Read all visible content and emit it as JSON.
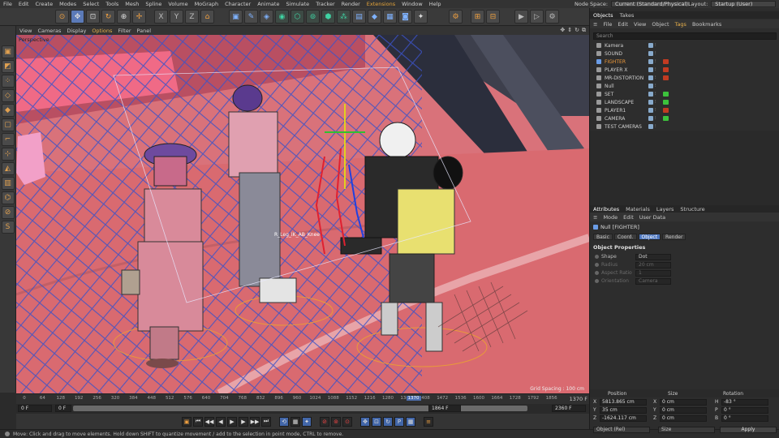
{
  "menubar": {
    "items": [
      "File",
      "Edit",
      "Create",
      "Modes",
      "Select",
      "Tools",
      "Mesh",
      "Spline",
      "Volume",
      "MoGraph",
      "Character",
      "Animate",
      "Simulate",
      "Tracker",
      "Render",
      "Extensions",
      "Window",
      "Help"
    ],
    "node_space_label": "Node Space:",
    "node_space_value": "Current (Standard/Physical)",
    "layout_label": "Layout:",
    "layout_value": "Startup (User)"
  },
  "viewport": {
    "menu": [
      "View",
      "Cameras",
      "Display",
      "Options",
      "Filter",
      "Panel"
    ],
    "label": "Perspective",
    "grid_spacing": "Grid Spacing : 100 cm",
    "bone_label": "R_Leg_IK_AB_Knee"
  },
  "timeline": {
    "ticks": [
      "0",
      "64",
      "128",
      "192",
      "256",
      "320",
      "384",
      "448",
      "512",
      "576",
      "640",
      "704",
      "768",
      "832",
      "896",
      "960",
      "1024",
      "1088",
      "1152",
      "1216",
      "1280",
      "1344",
      "1408",
      "1472",
      "1536",
      "1600",
      "1664",
      "1728",
      "1792",
      "1856"
    ],
    "current_frame": "1370",
    "end_display": "1370 F",
    "range_start": "0 F",
    "range_start2": "0 F",
    "range_mid": "1864 F",
    "range_end": "2360 F"
  },
  "status": {
    "text": "Move: Click and drag to move elements. Hold down SHIFT to quantize movement / add to the selection in point mode, CTRL to remove."
  },
  "objects_panel": {
    "tabs": [
      "Objects",
      "Takes"
    ],
    "menu": [
      "File",
      "Edit",
      "View",
      "Object",
      "Tags",
      "Bookmarks"
    ],
    "search_placeholder": "Search",
    "items": [
      {
        "name": "Kamera",
        "color": "#9a9a9a",
        "name_color": "#d0d0d0",
        "tag": ""
      },
      {
        "name": "SOUND",
        "color": "#9a9a9a",
        "name_color": "#d0d0d0",
        "tag": ""
      },
      {
        "name": "FIGHTER",
        "color": "#6a9ce6",
        "name_color": "#f09a3a",
        "tag": "#c23b22"
      },
      {
        "name": "PLAYER X",
        "color": "#9a9a9a",
        "name_color": "#d0d0d0",
        "tag": "#c23b22"
      },
      {
        "name": "MR-DISTORTION",
        "color": "#9a9a9a",
        "name_color": "#d0d0d0",
        "tag": "#c23b22"
      },
      {
        "name": "Null",
        "color": "#9a9a9a",
        "name_color": "#d0d0d0",
        "tag": ""
      },
      {
        "name": "SET",
        "color": "#9a9a9a",
        "name_color": "#d0d0d0",
        "tag": "#3cc23c"
      },
      {
        "name": "LANDSCAPE",
        "color": "#9a9a9a",
        "name_color": "#d0d0d0",
        "tag": "#3cc23c"
      },
      {
        "name": "PLAYER1",
        "color": "#9a9a9a",
        "name_color": "#d0d0d0",
        "tag": "#c23b22"
      },
      {
        "name": "CAMERA",
        "color": "#9a9a9a",
        "name_color": "#d0d0d0",
        "tag": "#3cc23c"
      },
      {
        "name": "TEST CAMERAS",
        "color": "#9a9a9a",
        "name_color": "#d0d0d0",
        "tag": ""
      }
    ]
  },
  "attributes_panel": {
    "tabs": [
      "Attributes",
      "Materials",
      "Layers",
      "Structure"
    ],
    "menu": [
      "Mode",
      "Edit",
      "User Data"
    ],
    "title": "Null [FIGHTER]",
    "subtabs": [
      "Basic",
      "Coord.",
      "Object",
      "Render"
    ],
    "active_subtab": "Object",
    "section": "Object Properties",
    "props": [
      {
        "label": "Shape",
        "value": "Dot",
        "dim": false
      },
      {
        "label": "Radius",
        "value": "20 cm",
        "dim": true
      },
      {
        "label": "Aspect Ratio",
        "value": "1",
        "dim": true
      },
      {
        "label": "Orientation",
        "value": "Camera",
        "dim": true
      }
    ]
  },
  "coordinates": {
    "headers": [
      "Position",
      "Size",
      "Rotation"
    ],
    "rows": [
      {
        "pos_axis": "X",
        "pos": "5813.865 cm",
        "size_axis": "X",
        "size": "0 cm",
        "rot_axis": "H",
        "rot": "-83 °"
      },
      {
        "pos_axis": "Y",
        "pos": "35 cm",
        "size_axis": "Y",
        "size": "0 cm",
        "rot_axis": "P",
        "rot": "0 °"
      },
      {
        "pos_axis": "Z",
        "pos": "-1624.117 cm",
        "size_axis": "Z",
        "size": "0 cm",
        "rot_axis": "B",
        "rot": "0 °"
      }
    ],
    "mode": "Object (Rel)",
    "size_mode": "Size",
    "apply_label": "Apply"
  }
}
